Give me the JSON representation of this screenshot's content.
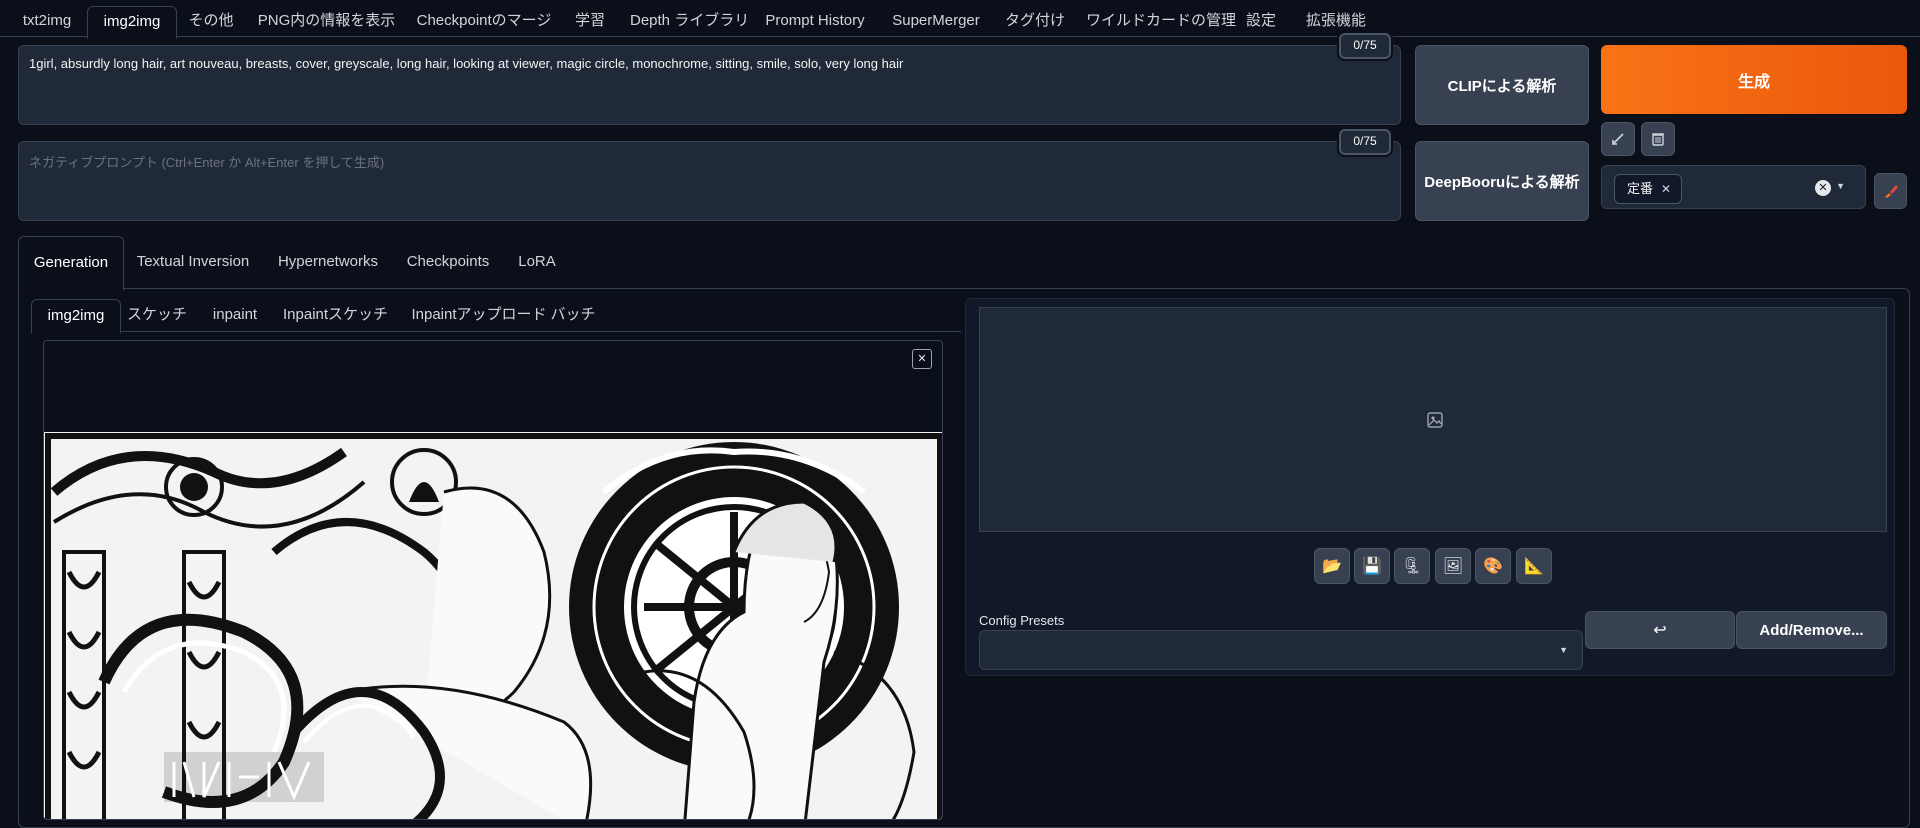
{
  "top_tabs": [
    {
      "label": "txt2img"
    },
    {
      "label": "img2img"
    },
    {
      "label": "その他"
    },
    {
      "label": "PNG内の情報を表示"
    },
    {
      "label": "Checkpointのマージ"
    },
    {
      "label": "学習"
    },
    {
      "label": "Depth ライブラリ"
    },
    {
      "label": "Prompt History"
    },
    {
      "label": "SuperMerger"
    },
    {
      "label": "タグ付け"
    },
    {
      "label": "ワイルドカードの管理"
    },
    {
      "label": "設定"
    },
    {
      "label": "拡張機能"
    }
  ],
  "prompt": {
    "value": "1girl, absurdly long hair, art nouveau, breasts, cover, greyscale, long hair, looking at viewer, magic circle, monochrome, sitting, smile, solo, very long hair",
    "counter": "0/75"
  },
  "negative_prompt": {
    "placeholder": "ネガティブプロンプト (Ctrl+Enter か Alt+Enter を押して生成)",
    "counter": "0/75"
  },
  "buttons": {
    "clip": "CLIPによる解析",
    "deepbooru": "DeepBooruによる解析",
    "generate": "生成"
  },
  "styles": {
    "chip": "定番"
  },
  "gen_tabs": [
    {
      "label": "Generation"
    },
    {
      "label": "Textual Inversion"
    },
    {
      "label": "Hypernetworks"
    },
    {
      "label": "Checkpoints"
    },
    {
      "label": "LoRA"
    }
  ],
  "sub_tabs": [
    {
      "label": "img2img"
    },
    {
      "label": "スケッチ"
    },
    {
      "label": "inpaint"
    },
    {
      "label": "Inpaintスケッチ"
    },
    {
      "label": "Inpaintアップロード"
    },
    {
      "label": "バッチ"
    }
  ],
  "config": {
    "label": "Config Presets",
    "swap_symbol": "↩",
    "add_remove": "Add/Remove..."
  },
  "output_tools": [
    {
      "icon": "folder-icon",
      "glyph": "📂"
    },
    {
      "icon": "save-icon",
      "glyph": "💾"
    },
    {
      "icon": "zip-icon",
      "glyph": "🗜"
    },
    {
      "icon": "image-icon",
      "glyph": "🖼"
    },
    {
      "icon": "palette-icon",
      "glyph": "🎨"
    },
    {
      "icon": "ruler-icon",
      "glyph": "📐"
    }
  ],
  "colors": {
    "accent": "#f97316",
    "background": "#0b0f19",
    "panel": "#1f2937"
  }
}
